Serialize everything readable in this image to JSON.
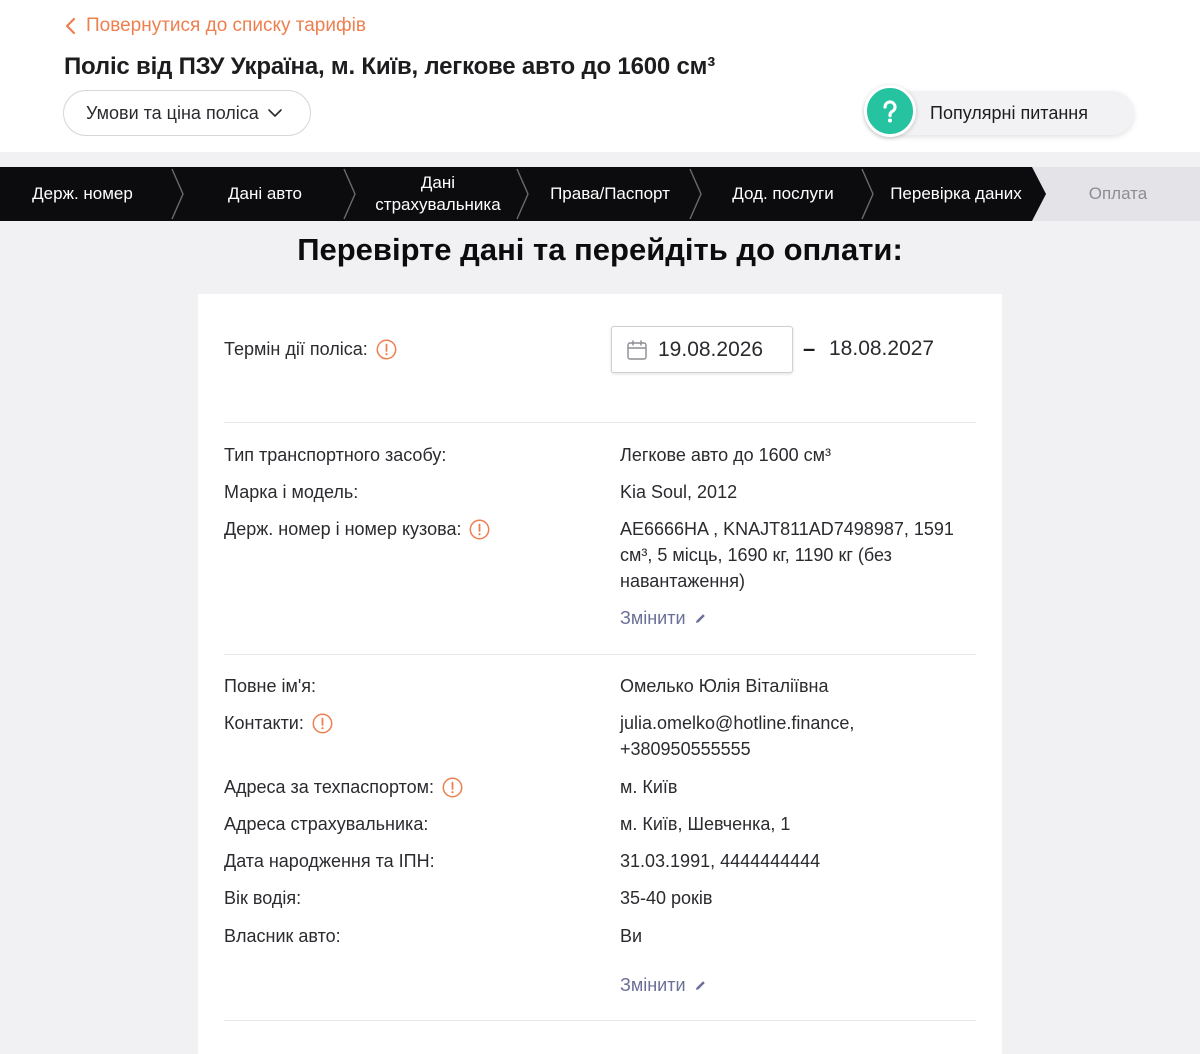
{
  "header": {
    "back_label": "Повернутися до списку тарифів",
    "title": "Поліс від ПЗУ Україна, м. Київ, легкове авто до 1600 см³",
    "conditions_label": "Умови та ціна поліса",
    "faq_label": "Популярні питання"
  },
  "stepper": {
    "steps": [
      {
        "label": "Держ. номер",
        "state": "done"
      },
      {
        "label": "Дані авто",
        "state": "done"
      },
      {
        "label": "Дані страхувальника",
        "state": "done"
      },
      {
        "label": "Права/Паспорт",
        "state": "done"
      },
      {
        "label": "Дод. послуги",
        "state": "done"
      },
      {
        "label": "Перевірка даних",
        "state": "current"
      },
      {
        "label": "Оплата",
        "state": "upcoming"
      }
    ]
  },
  "page": {
    "heading": "Перевірте дані та перейдіть до оплати:"
  },
  "policy_term": {
    "label": "Термін дії поліса:",
    "start_date": "19.08.2026",
    "separator": "–",
    "end_date": "18.08.2027"
  },
  "vehicle": {
    "type_label": "Тип транспортного засобу:",
    "type_value": "Легкове авто до 1600 см³",
    "model_label": "Марка і модель:",
    "model_value": "Kia Soul, 2012",
    "plate_label": "Держ. номер і номер кузова:",
    "plate_value": "AE6666HA , KNAJT811AD7498987, 1591 см³, 5 місць, 1690 кг, 1190 кг (без навантаження)",
    "change_label": "Змінити"
  },
  "insured": {
    "name_label": "Повне ім'я:",
    "name_value": "Омелько Юлія Віталіївна",
    "contacts_label": "Контакти:",
    "contacts_value": "julia.omelko@hotline.finance, +380950555555",
    "reg_address_label": "Адреса за техпаспортом:",
    "reg_address_value": "м. Київ",
    "address_label": "Адреса страхувальника:",
    "address_value": "м. Київ, Шевченка, 1",
    "birth_label": "Дата народження та ІПН:",
    "birth_value": "31.03.1991, 4444444444",
    "driver_age_label": "Вік водія:",
    "driver_age_value": "35-40 років",
    "owner_label": "Власник авто:",
    "owner_value": "Ви",
    "change_label": "Змінити"
  },
  "colors": {
    "accent_orange": "#ee7f4f",
    "faq_green": "#26c3a1",
    "link_purple": "#6b6f98",
    "stepper_dark": "#0c0c0e"
  }
}
